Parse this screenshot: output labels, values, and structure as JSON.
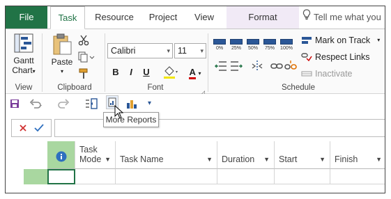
{
  "tabs": {
    "file": "File",
    "task": "Task",
    "resource": "Resource",
    "project": "Project",
    "view": "View",
    "format": "Format",
    "tellme": "Tell me what you"
  },
  "ribbon": {
    "view_group": {
      "gantt_label_1": "Gantt",
      "gantt_label_2": "Chart",
      "label": "View"
    },
    "clipboard_group": {
      "paste_label": "Paste",
      "label": "Clipboard"
    },
    "font_group": {
      "font_name": "Calibri",
      "font_size": "11",
      "bold": "B",
      "italic": "I",
      "underline": "U",
      "font_color": "A",
      "label": "Font"
    },
    "schedule_group": {
      "percent_buttons": [
        "0%",
        "25%",
        "50%",
        "75%",
        "100%"
      ],
      "mark_on_track": "Mark on Track",
      "respect_links": "Respect Links",
      "inactivate": "Inactivate",
      "label": "Schedule"
    }
  },
  "tooltip": "More Reports",
  "grid": {
    "headers": [
      {
        "line1": "Task",
        "line2": "Mode"
      },
      {
        "line1": "",
        "line2": "Task Name"
      },
      {
        "line1": "",
        "line2": "Duration"
      },
      {
        "line1": "",
        "line2": "Start"
      },
      {
        "line1": "",
        "line2": "Finish"
      }
    ]
  },
  "colors": {
    "brand": "#217346",
    "format_tab": "#f1eaf6",
    "row_selector": "#a9d7a0",
    "info_icon": "#2e6fbf"
  }
}
